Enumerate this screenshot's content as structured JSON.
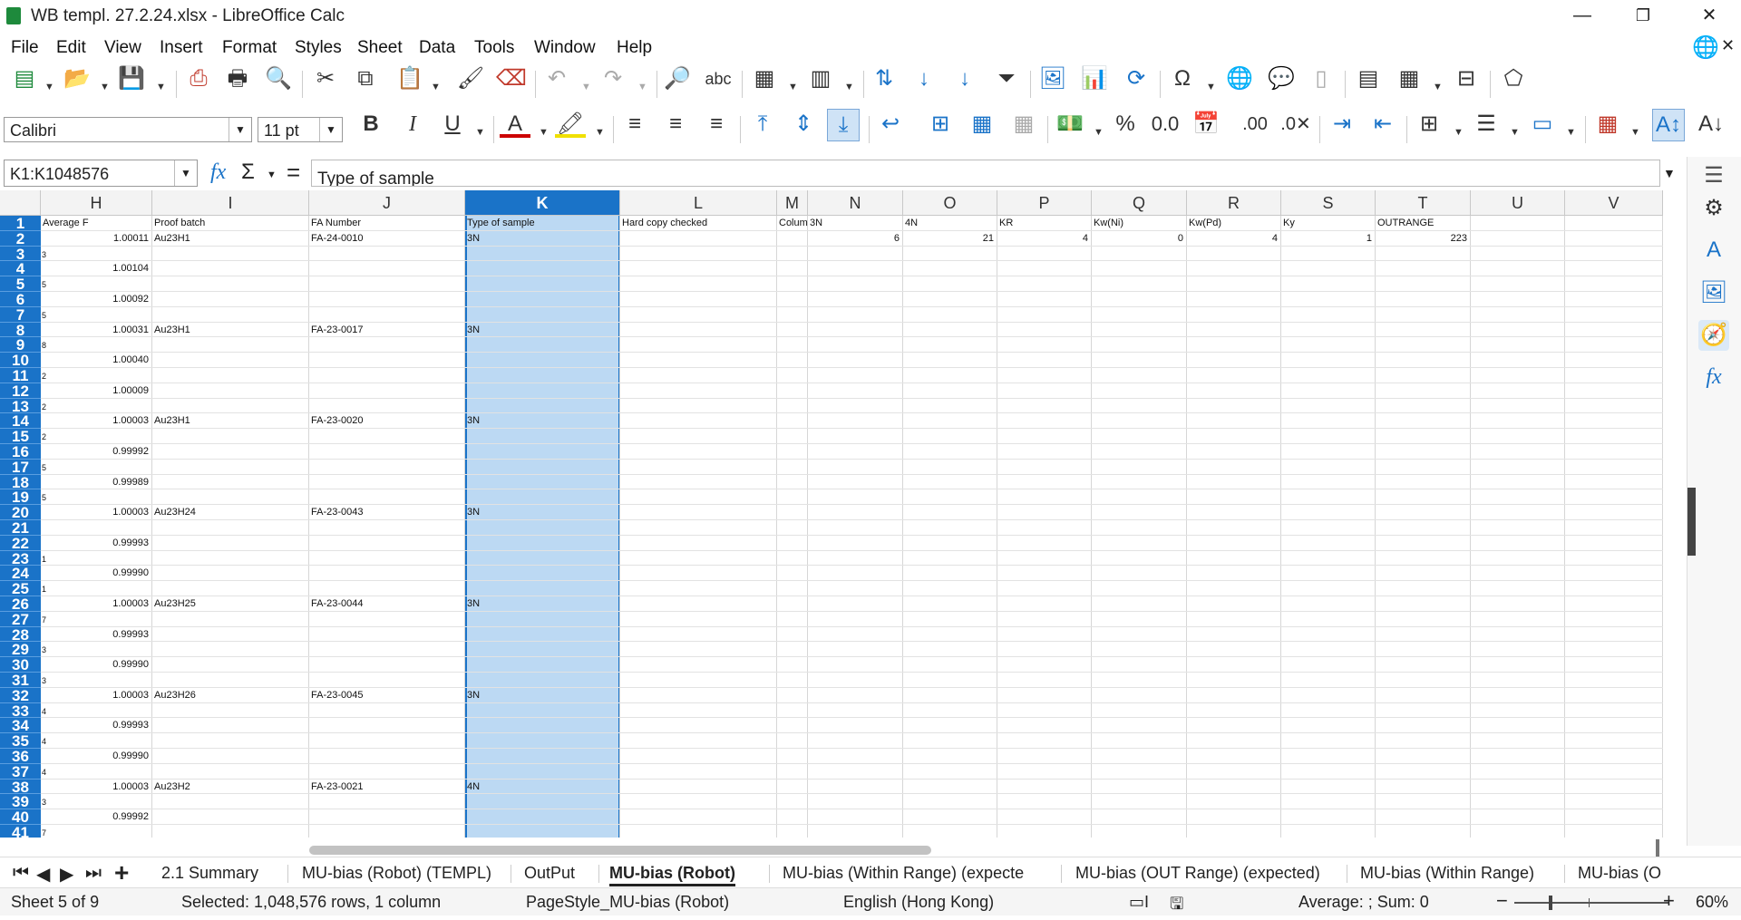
{
  "window": {
    "title": "WB templ. 27.2.24.xlsx - LibreOffice Calc",
    "minimize": "—",
    "maximize": "❐",
    "close": "✕"
  },
  "menu": [
    "File",
    "Edit",
    "View",
    "Insert",
    "Format",
    "Styles",
    "Sheet",
    "Data",
    "Tools",
    "Window",
    "Help"
  ],
  "toolbar": {
    "font_name": "Calibri",
    "font_size": "11 pt",
    "bold": "B",
    "italic": "I",
    "underline": "U"
  },
  "formula_bar": {
    "name_box": "K1:K1048576",
    "content": "Type of sample",
    "fx": "fx",
    "sum": "Σ",
    "equals": "="
  },
  "columns": [
    {
      "letter": "H",
      "header": "Average F"
    },
    {
      "letter": "I",
      "header": "Proof batch"
    },
    {
      "letter": "J",
      "header": "FA Number"
    },
    {
      "letter": "K",
      "header": "Type of sample"
    },
    {
      "letter": "L",
      "header": "Hard copy checked"
    },
    {
      "letter": "M",
      "header": "Colum"
    },
    {
      "letter": "N",
      "header": "3N"
    },
    {
      "letter": "O",
      "header": "4N"
    },
    {
      "letter": "P",
      "header": "KR"
    },
    {
      "letter": "Q",
      "header": "Kw(Ni)"
    },
    {
      "letter": "R",
      "header": "Kw(Pd)"
    },
    {
      "letter": "S",
      "header": "Ky"
    },
    {
      "letter": "T",
      "header": "OUTRANGE"
    },
    {
      "letter": "U",
      "header": ""
    },
    {
      "letter": "V",
      "header": ""
    }
  ],
  "row_numbers": [
    "1",
    "2",
    "3",
    "4",
    "5",
    "6",
    "7",
    "8",
    "9",
    "10",
    "11",
    "12",
    "13",
    "14",
    "15",
    "16",
    "17",
    "18",
    "19",
    "20",
    "21",
    "22",
    "23",
    "24",
    "25",
    "26",
    "27",
    "28",
    "29",
    "30",
    "31",
    "32",
    "33",
    "34",
    "35",
    "36",
    "37",
    "38",
    "39",
    "40",
    "41"
  ],
  "summary_row": {
    "N": "6",
    "O": "21",
    "P": "4",
    "Q": "0",
    "R": "4",
    "S": "1",
    "T": "223"
  },
  "rows": [
    {
      "row": 2,
      "H": "1.00011",
      "I": "Au23H1",
      "J": "FA-24-0010",
      "K": "3N"
    },
    {
      "row": 3,
      "frag": "3"
    },
    {
      "row": 4,
      "H": "1.00104"
    },
    {
      "row": 5,
      "frag": "5"
    },
    {
      "row": 6,
      "H": "1.00092"
    },
    {
      "row": 7,
      "frag": "5"
    },
    {
      "row": 8,
      "H": "1.00031",
      "I": "Au23H1",
      "J": "FA-23-0017",
      "K": "3N"
    },
    {
      "row": 9,
      "frag": "8"
    },
    {
      "row": 10,
      "H": "1.00040"
    },
    {
      "row": 11,
      "frag": "2"
    },
    {
      "row": 12,
      "H": "1.00009"
    },
    {
      "row": 13,
      "frag": "2"
    },
    {
      "row": 14,
      "H": "1.00003",
      "I": "Au23H1",
      "J": "FA-23-0020",
      "K": "3N"
    },
    {
      "row": 15,
      "frag": "2"
    },
    {
      "row": 16,
      "H": "0.99992"
    },
    {
      "row": 17,
      "frag": "5"
    },
    {
      "row": 18,
      "H": "0.99989"
    },
    {
      "row": 19,
      "frag": "5"
    },
    {
      "row": 20,
      "H": "1.00003",
      "I": "Au23H24",
      "J": "FA-23-0043",
      "K": "3N"
    },
    {
      "row": 21,
      "frag": ""
    },
    {
      "row": 22,
      "H": "0.99993"
    },
    {
      "row": 23,
      "frag": "1"
    },
    {
      "row": 24,
      "H": "0.99990"
    },
    {
      "row": 25,
      "frag": "1"
    },
    {
      "row": 26,
      "H": "1.00003",
      "I": "Au23H25",
      "J": "FA-23-0044",
      "K": "3N"
    },
    {
      "row": 27,
      "frag": "7"
    },
    {
      "row": 28,
      "H": "0.99993"
    },
    {
      "row": 29,
      "frag": "3"
    },
    {
      "row": 30,
      "H": "0.99990"
    },
    {
      "row": 31,
      "frag": "3"
    },
    {
      "row": 32,
      "H": "1.00003",
      "I": "Au23H26",
      "J": "FA-23-0045",
      "K": "3N"
    },
    {
      "row": 33,
      "frag": "4"
    },
    {
      "row": 34,
      "H": "0.99993"
    },
    {
      "row": 35,
      "frag": "4"
    },
    {
      "row": 36,
      "H": "0.99990"
    },
    {
      "row": 37,
      "frag": "4"
    },
    {
      "row": 38,
      "H": "1.00003",
      "I": "Au23H2",
      "J": "FA-23-0021",
      "K": "4N"
    },
    {
      "row": 39,
      "frag": "3"
    },
    {
      "row": 40,
      "H": "0.99992"
    },
    {
      "row": 41,
      "frag": "7"
    }
  ],
  "tabs": [
    "2.1 Summary",
    "MU-bias (Robot) (TEMPL)",
    "OutPut",
    "MU-bias (Robot)",
    "MU-bias (Within Range) (expecte",
    "MU-bias (OUT Range) (expected)",
    "MU-bias (Within Range)",
    "MU-bias (O"
  ],
  "active_tab": "MU-bias (Robot)",
  "status": {
    "sheet": "Sheet 5 of 9",
    "selection": "Selected: 1,048,576 rows, 1 column",
    "page_style": "PageStyle_MU-bias (Robot)",
    "language": "English (Hong Kong)",
    "aggregate": "Average: ; Sum: 0",
    "zoom": "60%"
  },
  "colors": {
    "selection": "#1a73c8",
    "selection_fill": "#bcd9f3",
    "text": "#222222"
  }
}
